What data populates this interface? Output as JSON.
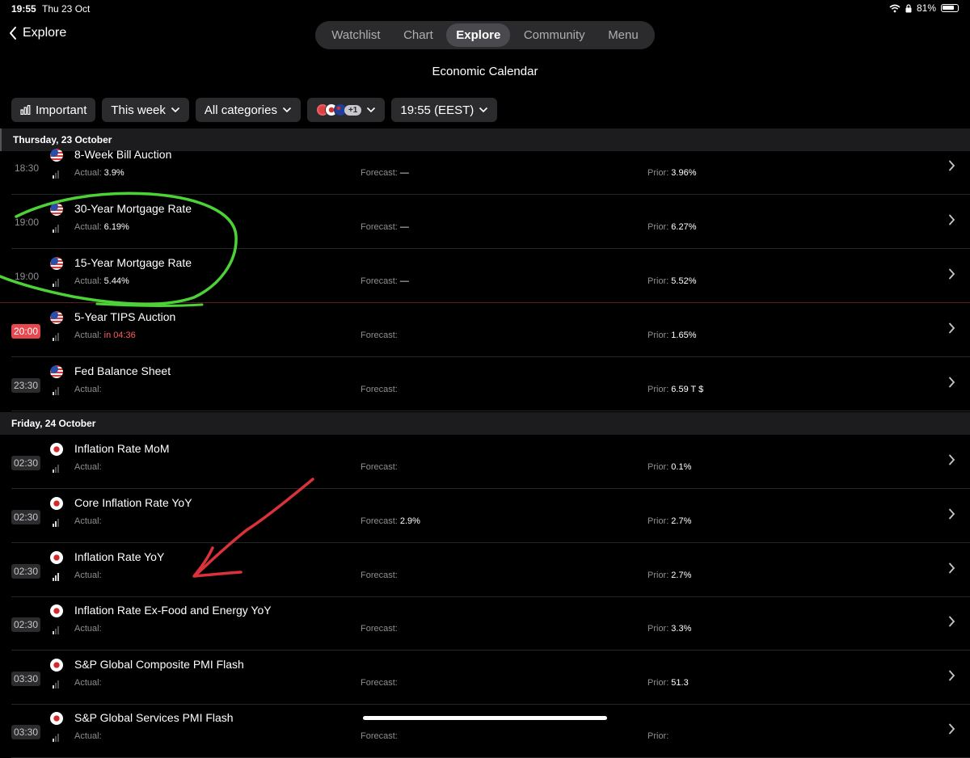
{
  "status": {
    "time": "19:55",
    "date": "Thu 23 Oct",
    "battery": "81%"
  },
  "nav": {
    "back_label": "Explore",
    "tabs": [
      {
        "label": "Watchlist"
      },
      {
        "label": "Chart"
      },
      {
        "label": "Explore",
        "active": true
      },
      {
        "label": "Community"
      },
      {
        "label": "Menu"
      }
    ],
    "page_title": "Economic Calendar"
  },
  "filters": {
    "importance": "Important",
    "period": "This week",
    "category": "All categories",
    "countries_more": "+1",
    "timezone": "19:55 (EEST)"
  },
  "labels": {
    "actual": "Actual:",
    "forecast": "Forecast:",
    "prior": "Prior:"
  },
  "days": [
    {
      "header": "Thursday, 23 October",
      "events": [
        {
          "time": "18:30",
          "country": "US",
          "title": "8-Week Bill Auction",
          "actual": "3.9%",
          "forecast": "—",
          "prior": "3.96%",
          "importance": 1
        },
        {
          "time": "19:00",
          "country": "US",
          "title": "30-Year Mortgage Rate",
          "actual": "6.19%",
          "forecast": "—",
          "prior": "6.27%",
          "importance": 1
        },
        {
          "time": "19:00",
          "country": "US",
          "title": "15-Year Mortgage Rate",
          "actual": "5.44%",
          "forecast": "—",
          "prior": "5.52%",
          "importance": 1
        },
        {
          "time": "20:00",
          "country": "US",
          "title": "5-Year TIPS Auction",
          "actual": "in 04:36",
          "forecast": "",
          "prior": "1.65%",
          "importance": 1,
          "live": true
        },
        {
          "time": "23:30",
          "country": "US",
          "title": "Fed Balance Sheet",
          "actual": "",
          "forecast": "",
          "prior": "6.59 T $",
          "importance": 1
        }
      ]
    },
    {
      "header": "Friday, 24 October",
      "events": [
        {
          "time": "02:30",
          "country": "JP",
          "title": "Inflation Rate MoM",
          "actual": "",
          "forecast": "",
          "prior": "0.1%",
          "importance": 1
        },
        {
          "time": "02:30",
          "country": "JP",
          "title": "Core Inflation Rate YoY",
          "actual": "",
          "forecast": "2.9%",
          "prior": "2.7%",
          "importance": 2
        },
        {
          "time": "02:30",
          "country": "JP",
          "title": "Inflation Rate YoY",
          "actual": "",
          "forecast": "",
          "prior": "2.7%",
          "importance": 3
        },
        {
          "time": "02:30",
          "country": "JP",
          "title": "Inflation Rate Ex-Food and Energy YoY",
          "actual": "",
          "forecast": "",
          "prior": "3.3%",
          "importance": 1
        },
        {
          "time": "03:30",
          "country": "JP",
          "title": "S&P Global Composite PMI Flash",
          "actual": "",
          "forecast": "",
          "prior": "51.3",
          "importance": 1
        },
        {
          "time": "03:30",
          "country": "JP",
          "title": "S&P Global Services PMI Flash",
          "actual": "",
          "forecast": "",
          "prior": "",
          "importance": 1
        }
      ]
    }
  ],
  "colors": {
    "background": "#000000",
    "chip": "#2b2b2d",
    "live_red": "#e5484d",
    "annotation_green": "#4cd137",
    "annotation_red": "#d9323a"
  },
  "icons": {
    "back": "chevron-left-icon",
    "importance": "bar-chart-icon",
    "chevron": "chevron-right-icon",
    "wifi": "wifi-icon",
    "battery": "battery-icon"
  }
}
